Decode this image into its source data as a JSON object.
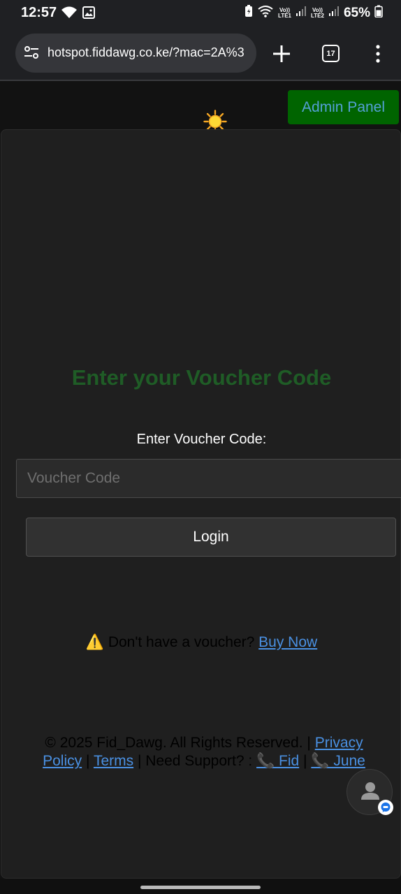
{
  "status_bar": {
    "time": "12:57",
    "lte1": "LTE1",
    "lte2": "LTE2",
    "volte": "Vo))",
    "battery": "65%"
  },
  "browser": {
    "url": "hotspot.fiddawg.co.ke/?mac=2A%3",
    "tab_count": "17"
  },
  "header": {
    "admin_button": "Admin Panel",
    "theme_icon": "sun-icon"
  },
  "form": {
    "title": "Enter your Voucher Code",
    "label": "Enter Voucher Code:",
    "placeholder": "Voucher Code",
    "login_button": "Login"
  },
  "buy": {
    "warning_symbol": "⚠️",
    "text": "Don't have a voucher?",
    "link": "Buy Now"
  },
  "footer": {
    "copyright": "© 2025 Fid_Dawg. All Rights Reserved. |",
    "privacy_link": "Privacy Policy",
    "sep1": "|",
    "terms_link": "Terms",
    "support_text": "| Need Support? :",
    "fid_link": "📞 Fid",
    "sep2": "|",
    "june_link": "📞 June"
  },
  "colors": {
    "admin_bg": "#006400",
    "admin_text": "#54a0d6",
    "title": "#1f5c26",
    "link": "#4a90e2"
  }
}
